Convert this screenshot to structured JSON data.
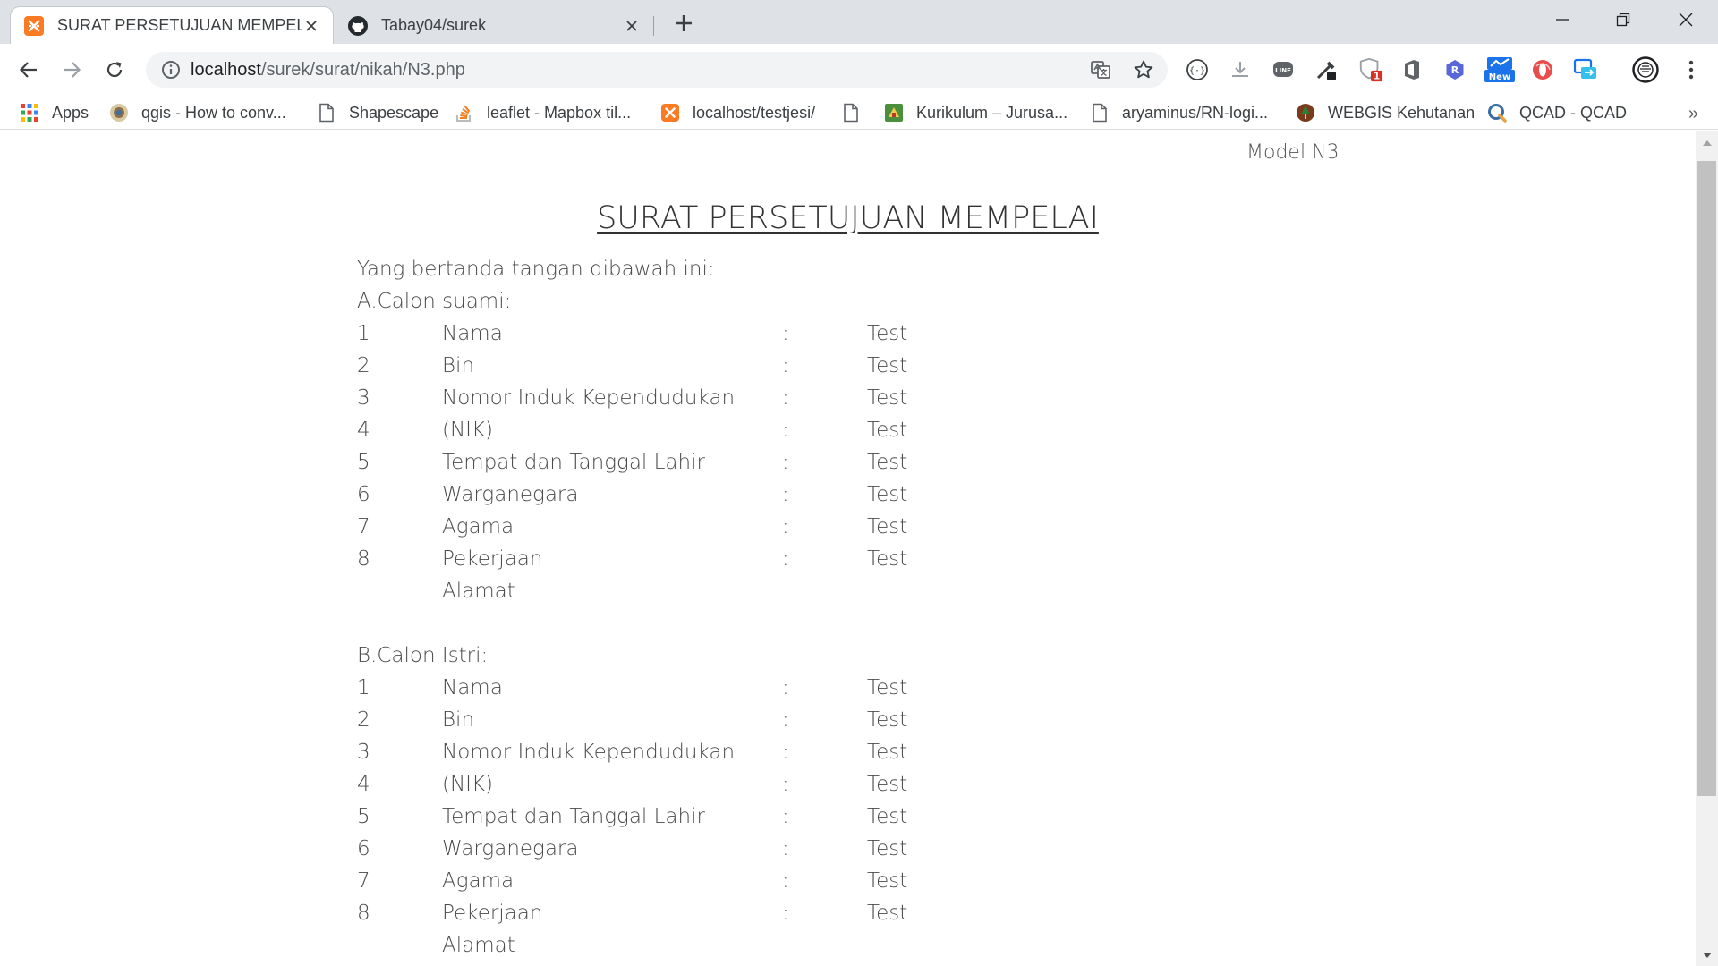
{
  "browser": {
    "tabs": [
      {
        "title": "SURAT PERSETUJUAN MEMPELAI",
        "icon": "xampp-icon",
        "active": true
      },
      {
        "title": "Tabay04/surek",
        "icon": "github-icon",
        "active": false
      }
    ],
    "url_host": "localhost",
    "url_path": "/surek/surat/nikah/N3.php",
    "bookmarks": [
      "Apps",
      "qgis - How to conv...",
      "Shapescape",
      "leaflet - Mapbox til...",
      "localhost/testjesi/",
      "",
      "Kurikulum – Jurusa...",
      "aryaminus/RN-logi...",
      "WEBGIS Kehutanan",
      "QCAD - QCAD"
    ],
    "extension_badges": {
      "shield_count": "1",
      "new_label": "New"
    },
    "colors": {
      "accent_orange": "#fb7a24",
      "tab_strip": "#dee1e6",
      "omnibox": "#f1f3f4"
    }
  },
  "page": {
    "model": "Model N3",
    "title": "SURAT PERSETUJUAN MEMPELAI",
    "intro": "Yang bertanda tangan dibawah ini:",
    "section_a": "A.Calon suami:",
    "section_b": "B.Calon Istri:",
    "rows_a": [
      {
        "num": "1",
        "label": "Nama",
        "colon": ":",
        "value": "Test"
      },
      {
        "num": "2",
        "label": "Bin",
        "colon": ":",
        "value": "Test"
      },
      {
        "num": "3",
        "label": "Nomor Induk Kependudukan",
        "colon": ":",
        "value": "Test"
      },
      {
        "num": "4",
        "label": "(NIK)",
        "colon": ":",
        "value": "Test"
      },
      {
        "num": "5",
        "label": "Tempat dan Tanggal Lahir",
        "colon": ":",
        "value": "Test"
      },
      {
        "num": "6",
        "label": "Warganegara",
        "colon": ":",
        "value": "Test"
      },
      {
        "num": "7",
        "label": "Agama",
        "colon": ":",
        "value": "Test"
      },
      {
        "num": "8",
        "label": "Pekerjaan",
        "colon": ":",
        "value": "Test"
      },
      {
        "num": "",
        "label": "Alamat",
        "colon": "",
        "value": ""
      }
    ],
    "rows_b": [
      {
        "num": "1",
        "label": "Nama",
        "colon": ":",
        "value": "Test"
      },
      {
        "num": "2",
        "label": "Bin",
        "colon": ":",
        "value": "Test"
      },
      {
        "num": "3",
        "label": "Nomor Induk Kependudukan",
        "colon": ":",
        "value": "Test"
      },
      {
        "num": "4",
        "label": "(NIK)",
        "colon": ":",
        "value": "Test"
      },
      {
        "num": "5",
        "label": "Tempat dan Tanggal Lahir",
        "colon": ":",
        "value": "Test"
      },
      {
        "num": "6",
        "label": "Warganegara",
        "colon": ":",
        "value": "Test"
      },
      {
        "num": "7",
        "label": "Agama",
        "colon": ":",
        "value": "Test"
      },
      {
        "num": "8",
        "label": "Pekerjaan",
        "colon": ":",
        "value": "Test"
      },
      {
        "num": "",
        "label": "Alamat",
        "colon": "",
        "value": ""
      }
    ]
  }
}
